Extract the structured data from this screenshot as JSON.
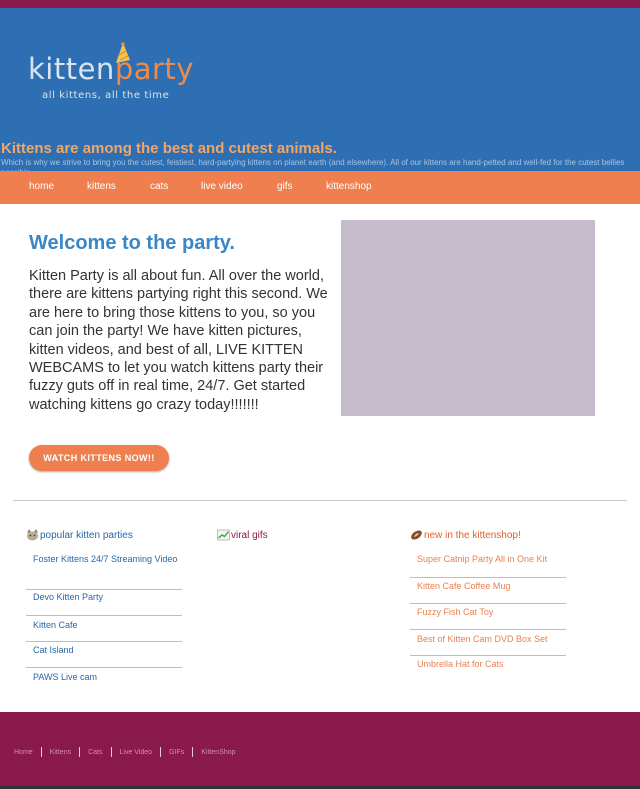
{
  "header": {
    "logo_kitten": "kitten",
    "logo_party": "party",
    "logo_tagline": "all kittens, all the time",
    "headline": "Kittens are among the best and cutest animals.",
    "subline": "Which is why we strive to bring you the cutest, feistiest, hard-partying kittens on planet earth (and elsewhere). All of our kittens are hand-petted and well-fed for the cutest bellies possible."
  },
  "nav": {
    "items": [
      {
        "label": "home"
      },
      {
        "label": "kittens"
      },
      {
        "label": "cats"
      },
      {
        "label": "live video"
      },
      {
        "label": "gifs"
      },
      {
        "label": "kittenshop"
      }
    ]
  },
  "main": {
    "title": "Welcome to the party.",
    "body": "Kitten Party is all about fun. All over the world, there are kittens partying right this second. We are here to bring those kittens to you, so you can join the party! We have kitten pictures, kitten videos, and best of all, LIVE KITTEN WEBCAMS to let you watch kittens party their fuzzy guts off in real time, 24/7. Get started watching kittens go crazy today!!!!!!!",
    "cta_label": "WATCH KITTENS NOW!!"
  },
  "columns": {
    "popular": {
      "heading": "popular kitten parties",
      "icon": "cat-face-icon",
      "items": [
        {
          "label": "Foster Kittens 24/7 Streaming Video"
        },
        {
          "label": "Devo Kitten Party"
        },
        {
          "label": "Kitten Cafe"
        },
        {
          "label": "Cat Island"
        },
        {
          "label": "PAWS Live cam"
        }
      ]
    },
    "viral": {
      "heading": "viral gifs",
      "icon": "chart-up-icon",
      "items": []
    },
    "shop": {
      "heading": "new in the kittenshop!",
      "icon": "football-icon",
      "items": [
        {
          "label": "Super Catnip Party All in One Kit"
        },
        {
          "label": "Kitten Cafe Coffee Mug"
        },
        {
          "label": "Fuzzy Fish Cat Toy"
        },
        {
          "label": "Best of Kitten Cam DVD Box Set"
        },
        {
          "label": "Umbrella Hat for Cats"
        }
      ]
    }
  },
  "footer": {
    "items": [
      {
        "label": "Home"
      },
      {
        "label": "Kittens"
      },
      {
        "label": "Cats"
      },
      {
        "label": "Live Video"
      },
      {
        "label": "GIFs"
      },
      {
        "label": "KittenShop"
      }
    ]
  },
  "colors": {
    "header_blue": "#2e6fb4",
    "nav_orange": "#ef7f4e",
    "footer_maroon": "#8a1a4b",
    "title_blue": "#3a86c6",
    "hero_placeholder": "#c6bccc"
  }
}
